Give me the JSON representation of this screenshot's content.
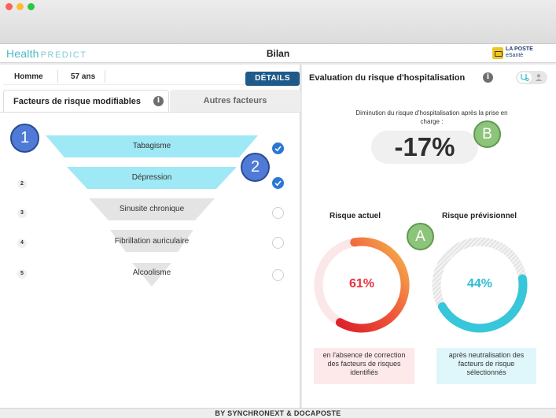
{
  "window": {
    "controls": [
      "close",
      "minimize",
      "maximize"
    ]
  },
  "header": {
    "brand_primary": "Health",
    "brand_secondary": "PREDICT",
    "title": "Bilan",
    "logo_line1": "LA POSTE",
    "logo_line2": "eSanté"
  },
  "patient": {
    "sex": "Homme",
    "age": "57 ans",
    "details_label": "DÉTAILS"
  },
  "tabs": [
    {
      "label": "Facteurs de risque modifiables",
      "active": true
    },
    {
      "label": "Autres facteurs",
      "active": false
    }
  ],
  "factors": [
    {
      "rank": "1",
      "label": "Tabagisme",
      "selected": true
    },
    {
      "rank": "2",
      "label": "Dépression",
      "selected": true
    },
    {
      "rank": "3",
      "label": "Sinusite chronique",
      "selected": false
    },
    {
      "rank": "4",
      "label": "Fibrillation auriculaire",
      "selected": false
    },
    {
      "rank": "5",
      "label": "Alcoolisme",
      "selected": false
    }
  ],
  "annotations": {
    "one": "1",
    "two": "2",
    "a": "A",
    "b": "B"
  },
  "evaluation": {
    "title": "Evaluation du risque d'hospitalisation",
    "reduction_caption": "Diminution du risque d'hospitalisation après la prise en charge :",
    "reduction_value": "-17%",
    "current": {
      "title": "Risque actuel",
      "value_text": "61%",
      "value": 0.61,
      "caption": "en l'absence de correction des facteurs de risques identifiés"
    },
    "forecast": {
      "title": "Risque prévisionnel",
      "value_text": "44%",
      "value": 0.44,
      "caption": "après neutralisation des facteurs de risque sélectionnés"
    }
  },
  "footer": {
    "text": "BY SYNCHRONEXT & DOCAPOSTE"
  },
  "colors": {
    "brand": "#4bb8c7",
    "details_button": "#1e5a8a",
    "funnel_active": "#9fe8f5",
    "funnel_inactive": "#e4e4e4",
    "check_on": "#2a78d2",
    "current_gauge_start": "#f5b94e",
    "current_gauge_end": "#dd1f2a",
    "forecast_gauge": "#38c6da"
  }
}
